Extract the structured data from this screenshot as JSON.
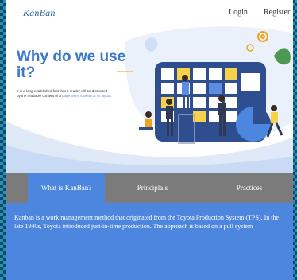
{
  "header": {
    "logo": "KanBan",
    "login": "Login",
    "register": "Register"
  },
  "hero": {
    "title": "Why do we use it?",
    "text": "It is a long established fact that a reader will be distracted by the readable content of a",
    "text_faded": "page when looking at its layout."
  },
  "tabs": [
    {
      "label": "What is KanBan?",
      "active": true
    },
    {
      "label": "Principlals",
      "active": false
    },
    {
      "label": "Practices",
      "active": false
    }
  ],
  "content": {
    "paragraph": "Kanban is a work management method that originated from the Toyota Production System (TPS). In the late 1940s, Toyota introduced just-in-time production. The approach is based on a pull system"
  },
  "colors": {
    "accent": "#4d86de",
    "tab_bar": "#7b7b7b",
    "title": "#3a78c8"
  }
}
